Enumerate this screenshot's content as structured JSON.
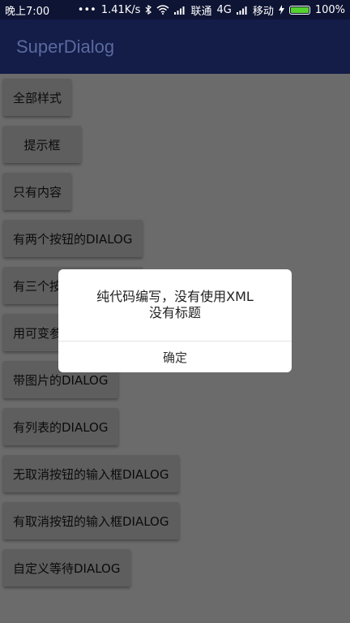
{
  "status_bar": {
    "time": "晚上7:00",
    "speed": "1.41K/s",
    "carrier1": "联通",
    "network": "4G",
    "carrier2": "移动",
    "battery": "100%",
    "icons": [
      "dots-icon",
      "bluetooth-icon",
      "wifi-icon",
      "signal-icon",
      "signal-icon",
      "charging-icon",
      "battery-icon"
    ]
  },
  "app_bar": {
    "title": "SuperDialog"
  },
  "buttons": [
    "全部样式",
    "提示框",
    "只有内容",
    "有两个按钮的DIALOG",
    "有三个按钮的DIALOG",
    "用可变参数的DIALOG",
    "带图片的DIALOG",
    "有列表的DIALOG",
    "无取消按钮的输入框DIALOG",
    "有取消按钮的输入框DIALOG",
    "自定义等待DIALOG"
  ],
  "dialog": {
    "line1": "纯代码编写，没有使用XML",
    "line2": "没有标题",
    "confirm": "确定"
  },
  "colors": {
    "status_bar": "#0e1433",
    "app_bar": "#141c48",
    "scrim_background": "#6b6b6b",
    "battery_fill": "#53d22e"
  }
}
